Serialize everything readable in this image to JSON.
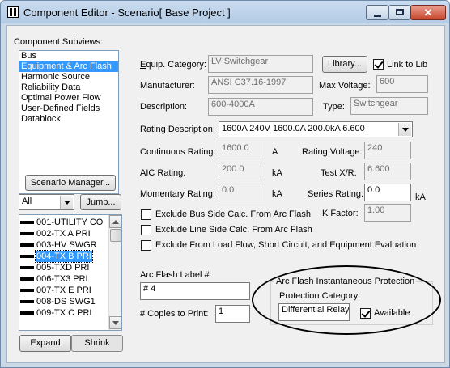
{
  "window": {
    "title": "Component Editor  - Scenario[ Base Project ]"
  },
  "left": {
    "subviews_label": "Component Subviews:",
    "subviews": [
      {
        "label": "Bus",
        "selected": false
      },
      {
        "label": "Equipment & Arc Flash",
        "selected": true
      },
      {
        "label": "Harmonic Source",
        "selected": false
      },
      {
        "label": "Reliability Data",
        "selected": false
      },
      {
        "label": "Optimal Power Flow",
        "selected": false
      },
      {
        "label": "User-Defined Fields",
        "selected": false
      },
      {
        "label": "Datablock",
        "selected": false
      }
    ],
    "scenario_button": "Scenario Manager...",
    "filter_value": "All",
    "jump_button": "Jump...",
    "devices": [
      {
        "label": "001-UTILITY CO",
        "selected": false
      },
      {
        "label": "002-TX A PRI",
        "selected": false
      },
      {
        "label": "003-HV SWGR",
        "selected": false
      },
      {
        "label": "004-TX B PRI",
        "selected": true
      },
      {
        "label": "005-TXD PRI",
        "selected": false
      },
      {
        "label": "006-TX3 PRI",
        "selected": false
      },
      {
        "label": "007-TX E PRI",
        "selected": false
      },
      {
        "label": "008-DS SWG1",
        "selected": false
      },
      {
        "label": "009-TX C PRI",
        "selected": false
      }
    ],
    "expand_button": "Expand",
    "shrink_button": "Shrink"
  },
  "form": {
    "equip_category_label": "Equip. Category:",
    "equip_category_value": "LV Switchgear",
    "library_button": "Library...",
    "link_to_lib_label": "Link to Lib",
    "link_to_lib_checked": true,
    "manufacturer_label": "Manufacturer:",
    "manufacturer_value": "ANSI C37.16-1997",
    "max_voltage_label": "Max Voltage:",
    "max_voltage_value": "600",
    "description_label": "Description:",
    "description_value": "600-4000A",
    "type_label": "Type:",
    "type_value": "Switchgear",
    "rating_description_label": "Rating Description:",
    "rating_description_value": "1600A 240V 1600.0A 200.0kA 6.600",
    "continuous_rating_label": "Continuous Rating:",
    "continuous_rating_value": "1600.0",
    "continuous_rating_unit": "A",
    "rating_voltage_label": "Rating Voltage:",
    "rating_voltage_value": "240",
    "aic_rating_label": "AIC Rating:",
    "aic_rating_value": "200.0",
    "aic_rating_unit": "kA",
    "test_xr_label": "Test X/R:",
    "test_xr_value": "6.600",
    "momentary_rating_label": "Momentary Rating:",
    "momentary_rating_value": "0.0",
    "momentary_rating_unit": "kA",
    "series_rating_label": "Series Rating:",
    "series_rating_value": "0.0",
    "series_rating_unit": "kA",
    "k_factor_label": "K Factor:",
    "k_factor_value": "1.00",
    "exclude_bus_side": "Exclude Bus Side Calc. From Arc Flash",
    "exclude_line_side": "Exclude Line Side Calc. From Arc Flash",
    "exclude_load_flow": "Exclude From Load Flow, Short Circuit, and Equipment Evaluation",
    "arc_flash_label_label": "Arc Flash Label #",
    "arc_flash_label_value": "# 4",
    "copies_label": "# Copies to Print:",
    "copies_value": "1",
    "instantaneous_group_title": "Arc Flash Instantaneous Protection",
    "protection_category_label": "Protection Category:",
    "protection_category_value": "Differential Relay",
    "available_label": "Available",
    "available_checked": true
  }
}
